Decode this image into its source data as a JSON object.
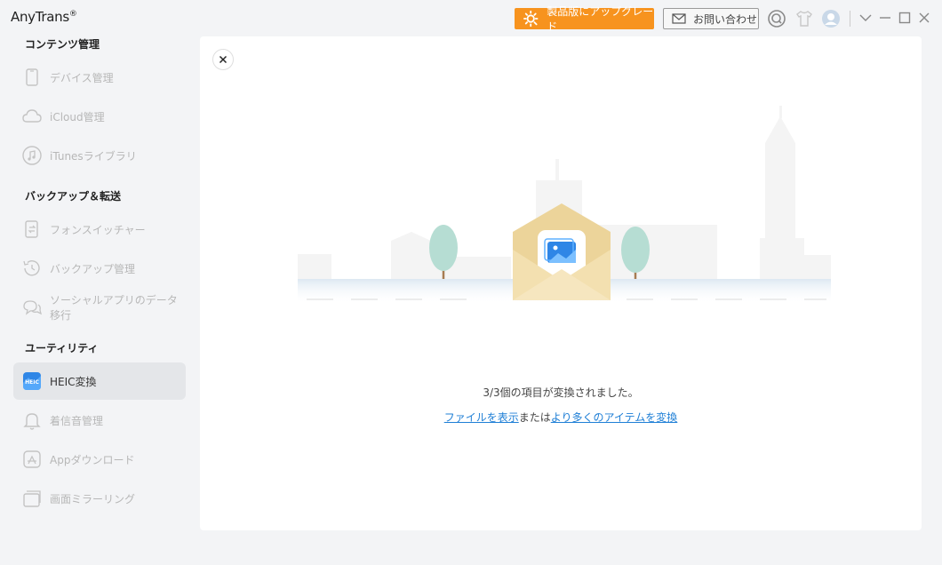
{
  "app": {
    "title": "AnyTrans",
    "trademark": "®"
  },
  "header": {
    "upgrade_label": "製品版にアップグレード",
    "contact_label": "お問い合わせ"
  },
  "sidebar": {
    "sections": [
      {
        "title": "コンテンツ管理"
      },
      {
        "title": "バックアップ＆転送"
      },
      {
        "title": "ユーティリティ"
      }
    ],
    "items": [
      {
        "label": "デバイス管理",
        "icon": "device-icon"
      },
      {
        "label": "iCloud管理",
        "icon": "cloud-icon"
      },
      {
        "label": "iTunesライブラリ",
        "icon": "music-icon"
      },
      {
        "label": "フォンスイッチャー",
        "icon": "phone-switch-icon"
      },
      {
        "label": "バックアップ管理",
        "icon": "backup-clock-icon"
      },
      {
        "label": "ソーシャルアプリのデータ移行",
        "icon": "chat-bubbles-icon"
      },
      {
        "label": "HEIC変換",
        "icon": "heic-icon",
        "active": true
      },
      {
        "label": "着信音管理",
        "icon": "bell-icon"
      },
      {
        "label": "Appダウンロード",
        "icon": "app-store-icon"
      },
      {
        "label": "画面ミラーリング",
        "icon": "screen-mirror-icon"
      }
    ],
    "heic_badge": "HEIC"
  },
  "main": {
    "result_text": "3/3個の項目が変換されました。",
    "show_files_link": "ファイルを表示",
    "or_text": "または",
    "convert_more_link": "より多くのアイテムを変換"
  },
  "colors": {
    "accent_orange": "#f7931e",
    "link_blue": "#1f7fd6",
    "active_bg": "#e4e6e9"
  }
}
